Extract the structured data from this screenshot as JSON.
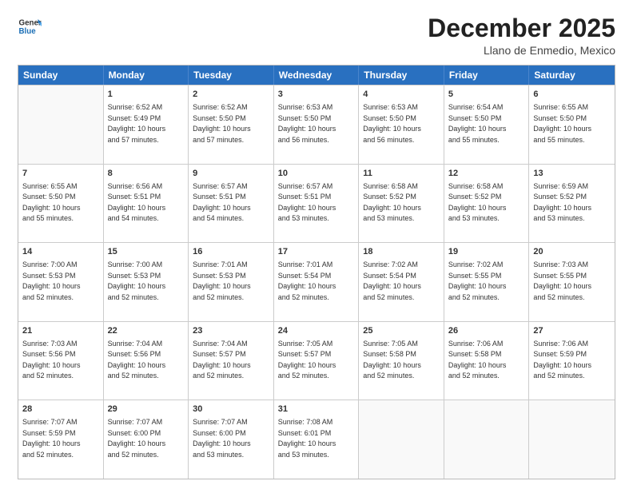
{
  "logo": {
    "line1": "General",
    "line2": "Blue"
  },
  "title": "December 2025",
  "location": "Llano de Enmedio, Mexico",
  "weekdays": [
    "Sunday",
    "Monday",
    "Tuesday",
    "Wednesday",
    "Thursday",
    "Friday",
    "Saturday"
  ],
  "rows": [
    [
      {
        "day": "",
        "info": ""
      },
      {
        "day": "1",
        "info": "Sunrise: 6:52 AM\nSunset: 5:49 PM\nDaylight: 10 hours\nand 57 minutes."
      },
      {
        "day": "2",
        "info": "Sunrise: 6:52 AM\nSunset: 5:50 PM\nDaylight: 10 hours\nand 57 minutes."
      },
      {
        "day": "3",
        "info": "Sunrise: 6:53 AM\nSunset: 5:50 PM\nDaylight: 10 hours\nand 56 minutes."
      },
      {
        "day": "4",
        "info": "Sunrise: 6:53 AM\nSunset: 5:50 PM\nDaylight: 10 hours\nand 56 minutes."
      },
      {
        "day": "5",
        "info": "Sunrise: 6:54 AM\nSunset: 5:50 PM\nDaylight: 10 hours\nand 55 minutes."
      },
      {
        "day": "6",
        "info": "Sunrise: 6:55 AM\nSunset: 5:50 PM\nDaylight: 10 hours\nand 55 minutes."
      }
    ],
    [
      {
        "day": "7",
        "info": "Sunrise: 6:55 AM\nSunset: 5:50 PM\nDaylight: 10 hours\nand 55 minutes."
      },
      {
        "day": "8",
        "info": "Sunrise: 6:56 AM\nSunset: 5:51 PM\nDaylight: 10 hours\nand 54 minutes."
      },
      {
        "day": "9",
        "info": "Sunrise: 6:57 AM\nSunset: 5:51 PM\nDaylight: 10 hours\nand 54 minutes."
      },
      {
        "day": "10",
        "info": "Sunrise: 6:57 AM\nSunset: 5:51 PM\nDaylight: 10 hours\nand 53 minutes."
      },
      {
        "day": "11",
        "info": "Sunrise: 6:58 AM\nSunset: 5:52 PM\nDaylight: 10 hours\nand 53 minutes."
      },
      {
        "day": "12",
        "info": "Sunrise: 6:58 AM\nSunset: 5:52 PM\nDaylight: 10 hours\nand 53 minutes."
      },
      {
        "day": "13",
        "info": "Sunrise: 6:59 AM\nSunset: 5:52 PM\nDaylight: 10 hours\nand 53 minutes."
      }
    ],
    [
      {
        "day": "14",
        "info": "Sunrise: 7:00 AM\nSunset: 5:53 PM\nDaylight: 10 hours\nand 52 minutes."
      },
      {
        "day": "15",
        "info": "Sunrise: 7:00 AM\nSunset: 5:53 PM\nDaylight: 10 hours\nand 52 minutes."
      },
      {
        "day": "16",
        "info": "Sunrise: 7:01 AM\nSunset: 5:53 PM\nDaylight: 10 hours\nand 52 minutes."
      },
      {
        "day": "17",
        "info": "Sunrise: 7:01 AM\nSunset: 5:54 PM\nDaylight: 10 hours\nand 52 minutes."
      },
      {
        "day": "18",
        "info": "Sunrise: 7:02 AM\nSunset: 5:54 PM\nDaylight: 10 hours\nand 52 minutes."
      },
      {
        "day": "19",
        "info": "Sunrise: 7:02 AM\nSunset: 5:55 PM\nDaylight: 10 hours\nand 52 minutes."
      },
      {
        "day": "20",
        "info": "Sunrise: 7:03 AM\nSunset: 5:55 PM\nDaylight: 10 hours\nand 52 minutes."
      }
    ],
    [
      {
        "day": "21",
        "info": "Sunrise: 7:03 AM\nSunset: 5:56 PM\nDaylight: 10 hours\nand 52 minutes."
      },
      {
        "day": "22",
        "info": "Sunrise: 7:04 AM\nSunset: 5:56 PM\nDaylight: 10 hours\nand 52 minutes."
      },
      {
        "day": "23",
        "info": "Sunrise: 7:04 AM\nSunset: 5:57 PM\nDaylight: 10 hours\nand 52 minutes."
      },
      {
        "day": "24",
        "info": "Sunrise: 7:05 AM\nSunset: 5:57 PM\nDaylight: 10 hours\nand 52 minutes."
      },
      {
        "day": "25",
        "info": "Sunrise: 7:05 AM\nSunset: 5:58 PM\nDaylight: 10 hours\nand 52 minutes."
      },
      {
        "day": "26",
        "info": "Sunrise: 7:06 AM\nSunset: 5:58 PM\nDaylight: 10 hours\nand 52 minutes."
      },
      {
        "day": "27",
        "info": "Sunrise: 7:06 AM\nSunset: 5:59 PM\nDaylight: 10 hours\nand 52 minutes."
      }
    ],
    [
      {
        "day": "28",
        "info": "Sunrise: 7:07 AM\nSunset: 5:59 PM\nDaylight: 10 hours\nand 52 minutes."
      },
      {
        "day": "29",
        "info": "Sunrise: 7:07 AM\nSunset: 6:00 PM\nDaylight: 10 hours\nand 52 minutes."
      },
      {
        "day": "30",
        "info": "Sunrise: 7:07 AM\nSunset: 6:00 PM\nDaylight: 10 hours\nand 53 minutes."
      },
      {
        "day": "31",
        "info": "Sunrise: 7:08 AM\nSunset: 6:01 PM\nDaylight: 10 hours\nand 53 minutes."
      },
      {
        "day": "",
        "info": ""
      },
      {
        "day": "",
        "info": ""
      },
      {
        "day": "",
        "info": ""
      }
    ]
  ]
}
